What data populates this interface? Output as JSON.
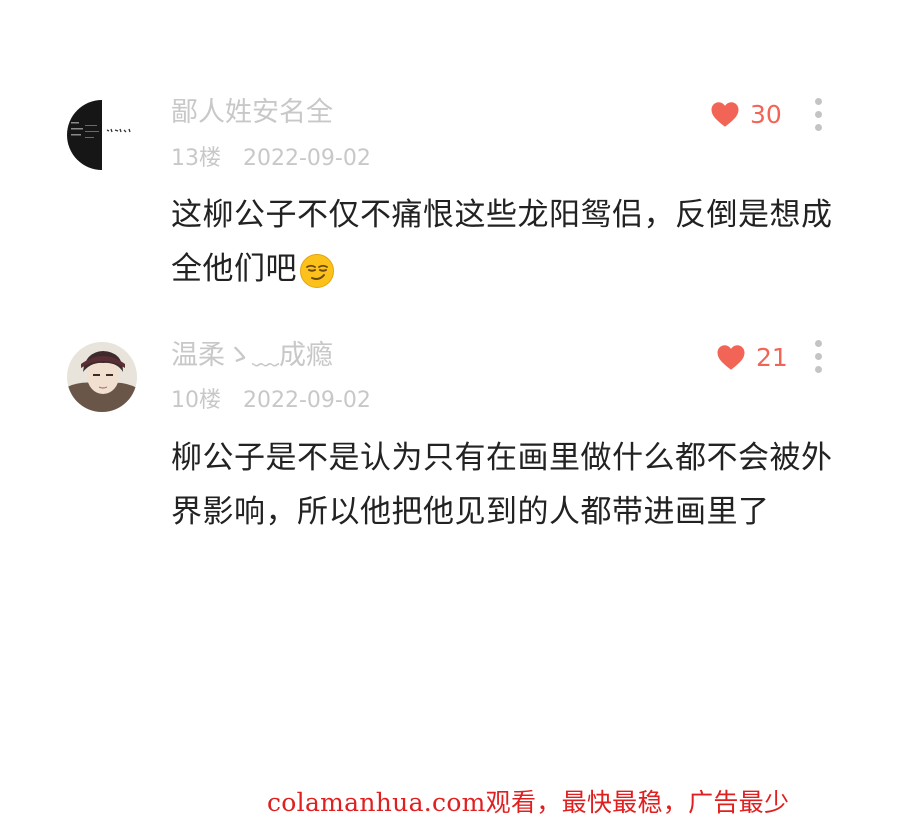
{
  "comments": [
    {
      "username": "鄙人姓安名全",
      "floor": "13楼",
      "date": "2022-09-02",
      "likes": "30",
      "text": "这柳公子不仅不痛恨这些龙阳鸳侣，反倒是想成全他们吧",
      "emoji": "smirk-emoji",
      "avatar_icon": "dark-calligraphy-avatar-icon"
    },
    {
      "username": "温柔ゝ﹏成瘾",
      "floor": "10楼",
      "date": "2022-09-02",
      "likes": "21",
      "text": "柳公子是不是认为只有在画里做什么都不会被外界影响，所以他把他见到的人都带进画里了",
      "avatar_icon": "anime-character-avatar-icon"
    }
  ],
  "watermark": "colamanhua.com观看，最快最稳，广告最少",
  "colors": {
    "like_red": "#f26556",
    "meta_gray": "#c8c8c8",
    "text_dark": "#222222",
    "watermark_red": "#e02020"
  }
}
